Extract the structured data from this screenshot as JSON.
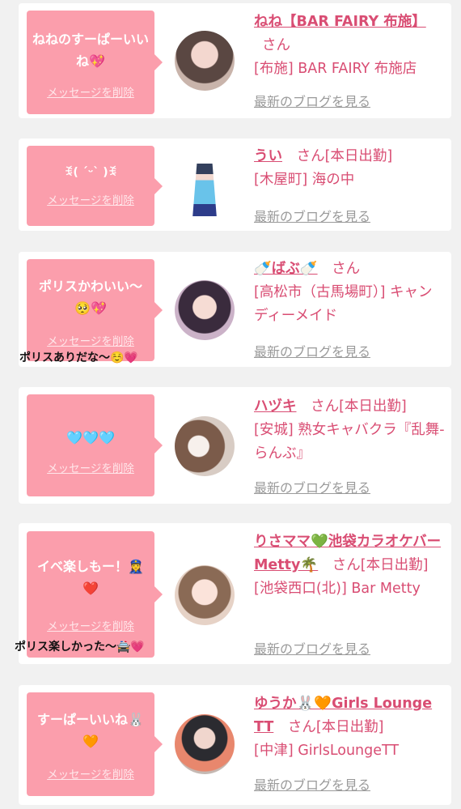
{
  "blog_link_label": "最新のブログを見る",
  "delete_label": "メッセージを削除",
  "colors": {
    "accent": "#d94d73",
    "bubble": "#fb9eac",
    "background": "#f1f1f1"
  },
  "cards": [
    {
      "message": "ねねのすーぱーいいね💖",
      "name": "ねね【BAR FAIRY 布施】",
      "san": "さん",
      "status": "",
      "shop": "[布施] BAR FAIRY 布施店",
      "reply": ""
    },
    {
      "message": "ꉂ( ˊᵕˋ )ꉂ",
      "name": "うい",
      "san": "さん",
      "status": "[本日出勤]",
      "shop": "[木屋町] 海の中",
      "reply": ""
    },
    {
      "message": "ポリスかわいい〜🥺💖",
      "name": "🍼ばぶ🍼",
      "san": "さん",
      "status": "",
      "shop": "[高松市（古馬場町）] キャンディーメイド",
      "reply": "ポリスありだな〜☺️💗"
    },
    {
      "message": "🩵🩵🩵",
      "name": "ハヅキ",
      "san": "さん",
      "status": "[本日出勤]",
      "shop": "[安城] 熟女キャバクラ『乱舞-らんぶ』",
      "reply": ""
    },
    {
      "message": "イベ楽しもー！👮‍♀️❤️",
      "name": "りさママ💚池袋カラオケバーMetty🌴",
      "san": "さん",
      "status": "[本日出勤]",
      "shop": "[池袋西口(北)] Bar Metty",
      "reply": "ポリス楽しかった〜🚔💗"
    },
    {
      "message": "すーぱーいいね🐰🧡",
      "name": "ゆうか🐰🧡Girls Lounge TT",
      "san": "さん",
      "status": "[本日出勤]",
      "shop": "[中津] GirlsLoungeTT",
      "reply": ""
    }
  ]
}
